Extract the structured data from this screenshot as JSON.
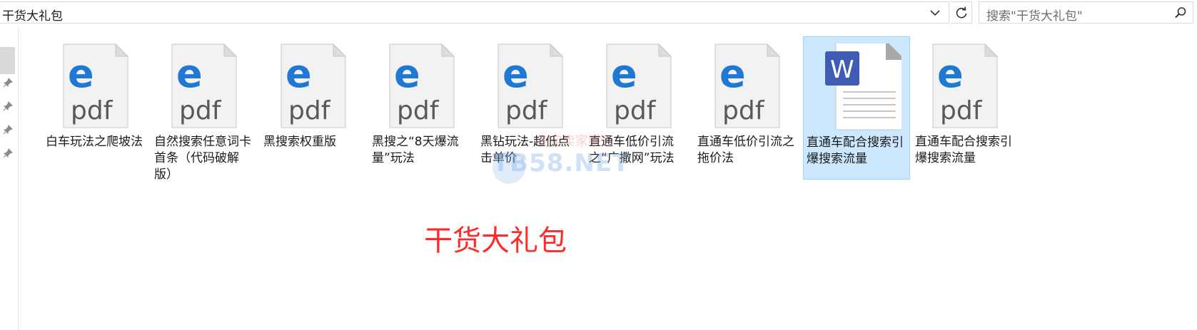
{
  "address_bar": {
    "path": "干货大礼包"
  },
  "search": {
    "placeholder": "搜索\"干货大礼包\""
  },
  "files": [
    {
      "name": "白车玩法之爬坡法",
      "type": "pdf",
      "icon_text": "pdf",
      "selected": false
    },
    {
      "name": "自然搜索任意词卡首条（代码破解版）",
      "type": "pdf",
      "icon_text": "pdf",
      "selected": false
    },
    {
      "name": "黑搜索权重版",
      "type": "pdf",
      "icon_text": "pdf",
      "selected": false
    },
    {
      "name": "黑搜之“8天爆流量”玩法",
      "type": "pdf",
      "icon_text": "pdf",
      "selected": false
    },
    {
      "name": "黑钻玩法-超低点击单价",
      "type": "pdf",
      "icon_text": "pdf",
      "selected": false
    },
    {
      "name": "直通车低价引流之“广撒网”玩法",
      "type": "pdf",
      "icon_text": "pdf",
      "selected": false
    },
    {
      "name": "直通车低价引流之拖价法",
      "type": "pdf",
      "icon_text": "pdf",
      "selected": false
    },
    {
      "name": "直通车配合搜索引爆搜索流量",
      "type": "wps",
      "icon_text": "W",
      "selected": true
    },
    {
      "name": "直通车配合搜索引爆搜索流量",
      "type": "pdf",
      "icon_text": "pdf",
      "selected": false
    }
  ],
  "watermark": {
    "text": "TB58.NET",
    "cn": "淘宝卖家服务"
  },
  "caption": "干货大礼包",
  "colors": {
    "edge_blue": "#1f78d1",
    "pdf_text": "#595959",
    "wps_blue": "#3f5bb3",
    "caption_red": "#ff2a2a",
    "selection": "#cce8ff"
  }
}
